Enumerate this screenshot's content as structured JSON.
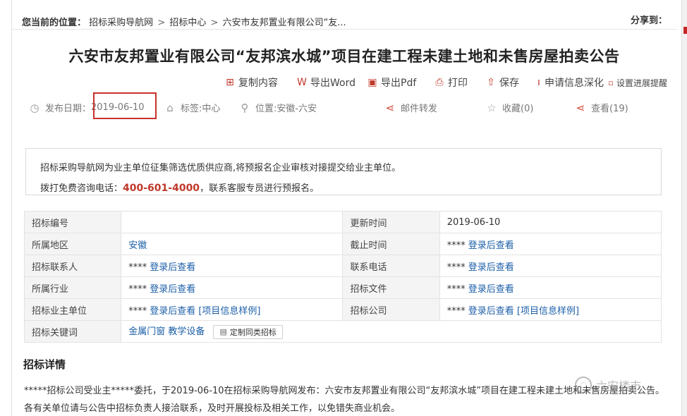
{
  "breadcrumb": {
    "lead": "您当前的位置：",
    "items": [
      "招标采购导航网",
      "招标中心",
      "六安市友邦置业有限公司“友..."
    ],
    "sep": ">",
    "share_label": "分享到："
  },
  "title": "六安市友邦置业有限公司“友邦滨水城”项目在建工程未建土地和未售房屋拍卖公告",
  "actions": {
    "copy": "复制内容",
    "export_word": "导出Word",
    "export_pdf": "导出Pdf",
    "print": "打印",
    "save": "保存",
    "deepen": "申请信息深化",
    "remind": "设置进展提醒"
  },
  "meta": {
    "date_label": "发布日期：",
    "date": "2019-06-10",
    "tag_label": "标签:中心",
    "location_label": "位置:安徽-六安",
    "mail": "邮件转发",
    "favorite": "收藏(0)",
    "views": "查看(19)"
  },
  "notice": {
    "line1": "招标采购导航网为业主单位征集筛选优质供应商,将预报名企业审核对接提交给业主单位。",
    "line2_pre": "拨打免费咨询电话：",
    "phone": "400-601-4000",
    "line2_post": "，联系客服专员进行预报名。"
  },
  "table": {
    "rows": [
      {
        "k1": "招标编号",
        "v1": "",
        "k2": "更新时间",
        "v2": "2019-06-10"
      },
      {
        "k1": "所属地区",
        "v1": "安徽",
        "k2": "截止时间",
        "v2_stars": "****",
        "v2_link": "登录后查看"
      },
      {
        "k1": "招标联系人",
        "v1_stars": "****",
        "v1_link": "登录后查看",
        "k2": "联系电话",
        "v2_stars": "****",
        "v2_link": "登录后查看"
      },
      {
        "k1": "所属行业",
        "v1_stars": "****",
        "v1_link": "登录后查看",
        "k2": "招标文件",
        "v2_stars": "****",
        "v2_link": "登录后查看"
      },
      {
        "k1": "招标业主单位",
        "v1_stars": "****",
        "v1_link": "登录后查看",
        "v1_extra": "[项目信息样例]",
        "k2": "招标公司",
        "v2_stars": "****",
        "v2_link": "登录后查看",
        "v2_extra": "[项目信息样例]"
      },
      {
        "k1": "招标关键词",
        "v1_link": "金属门窗 教学设备",
        "v1_button": "定制同类招标",
        "k2": "",
        "v2": ""
      }
    ]
  },
  "detail": {
    "heading": "招标详情",
    "text": "*****招标公司受业主*****委托，于2019-06-10在招标采购导航网发布：六安市友邦置业有限公司“友邦滨水城”项目在建工程未建土地和未售房屋拍卖公告。各有关单位请与公告中招标负责人接洽联系，及时开展投标及相关工作，以免错失商业机会。"
  },
  "watermark": {
    "text": "六安楼市"
  }
}
